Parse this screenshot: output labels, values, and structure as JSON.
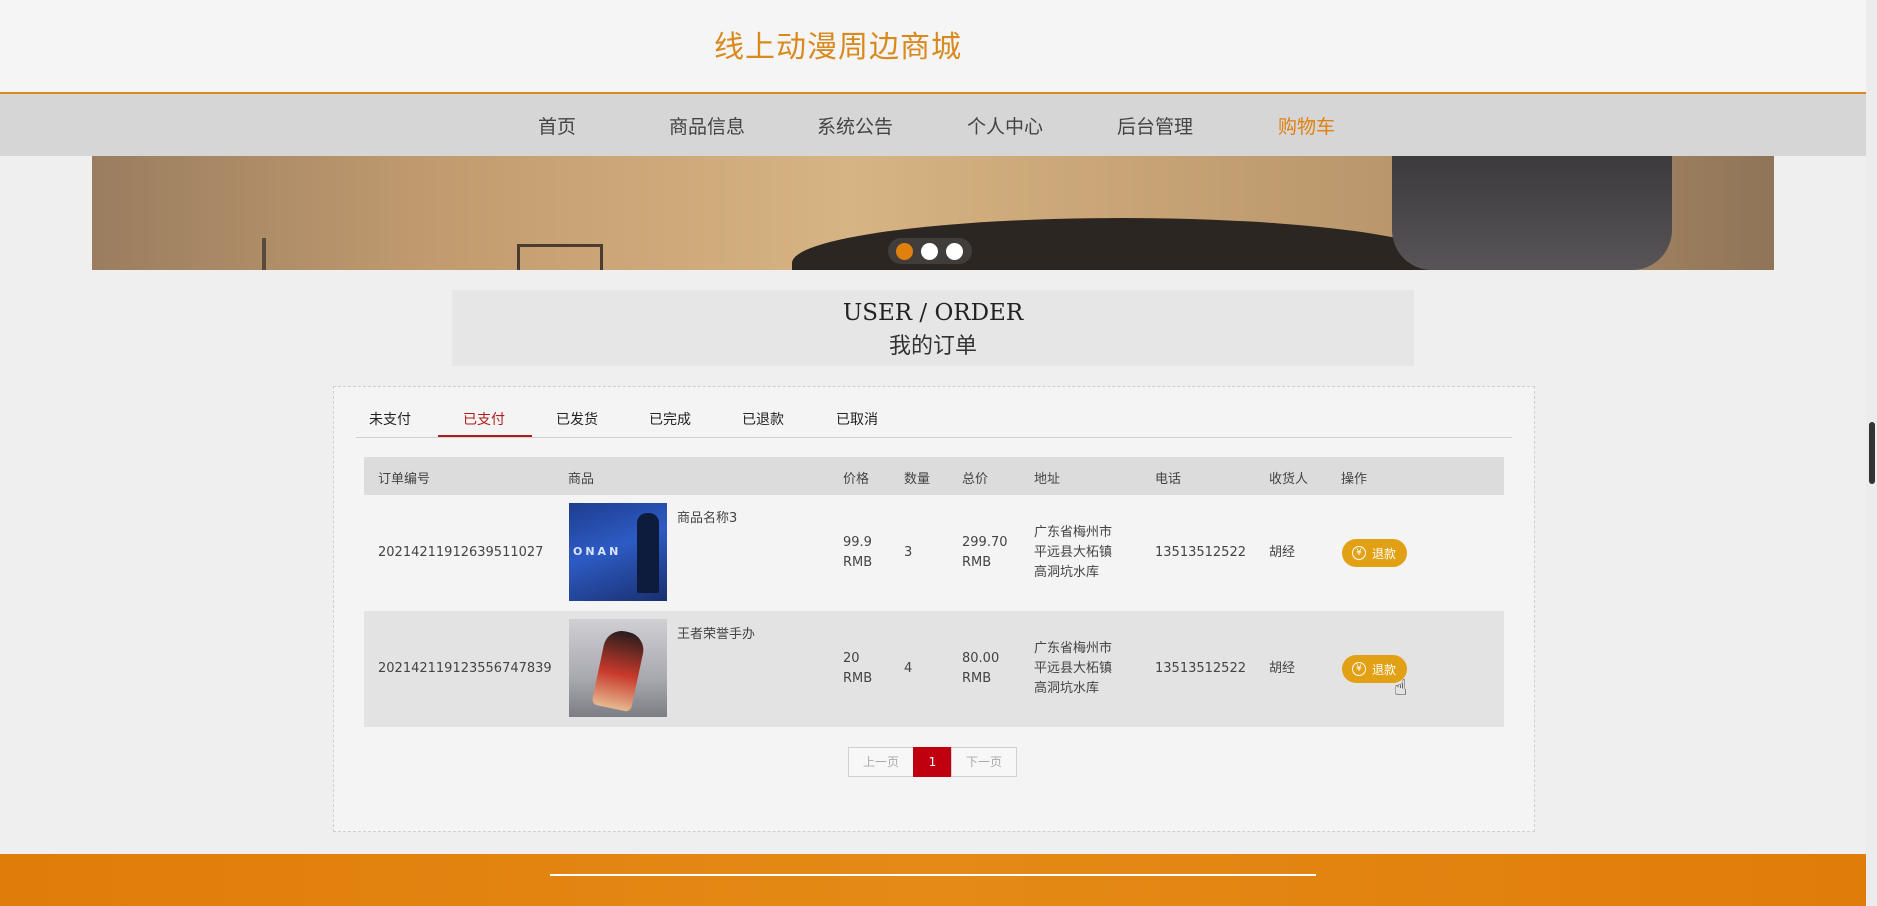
{
  "site": {
    "title": "线上动漫周边商城"
  },
  "nav": {
    "items": [
      {
        "label": "首页"
      },
      {
        "label": "商品信息"
      },
      {
        "label": "系统公告"
      },
      {
        "label": "个人中心"
      },
      {
        "label": "后台管理"
      },
      {
        "label": "购物车",
        "active": true
      }
    ]
  },
  "carousel": {
    "slide_count": 3,
    "active_index": 0
  },
  "page": {
    "title_en": "USER / ORDER",
    "title_cn": "我的订单"
  },
  "tabs": [
    {
      "label": "未支付"
    },
    {
      "label": "已支付",
      "active": true
    },
    {
      "label": "已发货"
    },
    {
      "label": "已完成"
    },
    {
      "label": "已退款"
    },
    {
      "label": "已取消"
    }
  ],
  "table": {
    "headers": [
      "订单编号",
      "商品",
      "价格",
      "数量",
      "总价",
      "地址",
      "电话",
      "收货人",
      "操作"
    ],
    "rows": [
      {
        "order_no": "20214211912639511027",
        "product_name": "商品名称3",
        "price": "99.9",
        "price_unit": "RMB",
        "qty": "3",
        "total": "299.70",
        "total_unit": "RMB",
        "address_lines": [
          "广东省梅州市",
          "平远县大柘镇",
          "高洞坑水库"
        ],
        "phone": "13513512522",
        "receiver": "胡经",
        "action": "退款",
        "image_text": "ONAN"
      },
      {
        "order_no": "20214211912355674783​9",
        "product_name": "王者荣誉手办",
        "price": "20",
        "price_unit": "RMB",
        "qty": "4",
        "total": "80.00",
        "total_unit": "RMB",
        "address_lines": [
          "广东省梅州市",
          "平远县大柘镇",
          "高洞坑水库"
        ],
        "phone": "13513512522",
        "receiver": "胡经",
        "action": "退款"
      }
    ]
  },
  "pagination": {
    "prev": "上一页",
    "current": "1",
    "next": "下一页"
  },
  "icons": {
    "refund": "yen-coin-icon",
    "cursor": "hand-pointer-icon"
  },
  "colors": {
    "brand": "#d98a1f",
    "active_nav": "#e0800e",
    "active_tab": "#b01c1c",
    "refund_button": "#e2a114",
    "page_current": "#c0000e"
  }
}
